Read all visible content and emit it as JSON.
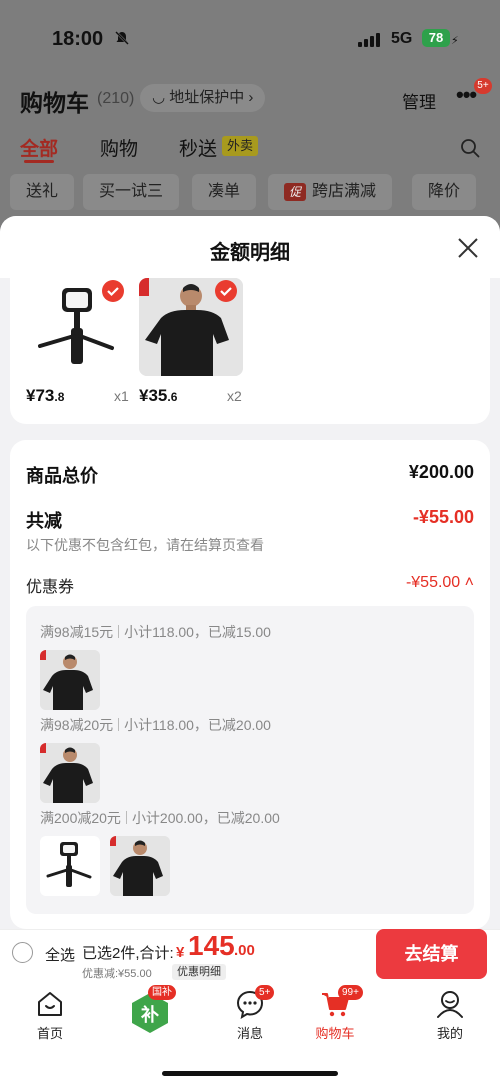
{
  "status_bar": {
    "time": "18:00",
    "network": "5G",
    "battery": "78"
  },
  "header": {
    "title": "购物车",
    "count": "(210)",
    "address": "地址保护中 ›",
    "manage": "管理",
    "more_badge": "5+"
  },
  "filter_tabs": [
    {
      "label": "全部"
    },
    {
      "label": "购物"
    },
    {
      "label": "秒送"
    },
    {
      "label": "外卖"
    }
  ],
  "chips": [
    "送礼",
    "买一试三",
    "凑单",
    "跨店满减",
    "降价"
  ],
  "chip_promo_tag": "促",
  "sheet": {
    "title": "金额明细",
    "products": [
      {
        "price_int": "¥73",
        "price_dec": ".8",
        "qty": "x1",
        "icon": "tripod-light"
      },
      {
        "price_int": "¥35",
        "price_dec": ".6",
        "qty": "x2",
        "icon": "black-polo"
      }
    ],
    "summary": {
      "goods_total_label": "商品总价",
      "goods_total_value": "¥200.00",
      "reduction_label": "共减",
      "reduction_value": "-¥55.00",
      "note": "以下优惠不包含红包，请在结算页查看",
      "coupon_label": "优惠券",
      "coupon_value": "-¥55.00",
      "coupons": [
        {
          "rule": "满98减15元",
          "detail": "小计118.00，已减15.00"
        },
        {
          "rule": "满98减20元",
          "detail": "小计118.00，已减20.00"
        },
        {
          "rule": "满200减20元",
          "detail": "小计200.00，已减20.00"
        }
      ]
    }
  },
  "checkout": {
    "select_all": "全选",
    "selected": "已选2件,合计:",
    "currency": "¥",
    "total_int": "145",
    "total_dec": ".00",
    "discount": "优惠减:¥55.00",
    "detail_tag": "优惠明细",
    "button": "去结算"
  },
  "tabbar": [
    {
      "label": "首页",
      "icon": "home-icon"
    },
    {
      "label": "",
      "icon": "subsidy-icon",
      "badge": "国补"
    },
    {
      "label": "消息",
      "icon": "message-icon",
      "badge": "5+"
    },
    {
      "label": "购物车",
      "icon": "cart-icon",
      "badge": "99+"
    },
    {
      "label": "我的",
      "icon": "profile-icon"
    }
  ],
  "colors": {
    "accent": "#e52f25",
    "checkout_button": "#ec3a3f",
    "overlay": "#7d7d7d"
  }
}
